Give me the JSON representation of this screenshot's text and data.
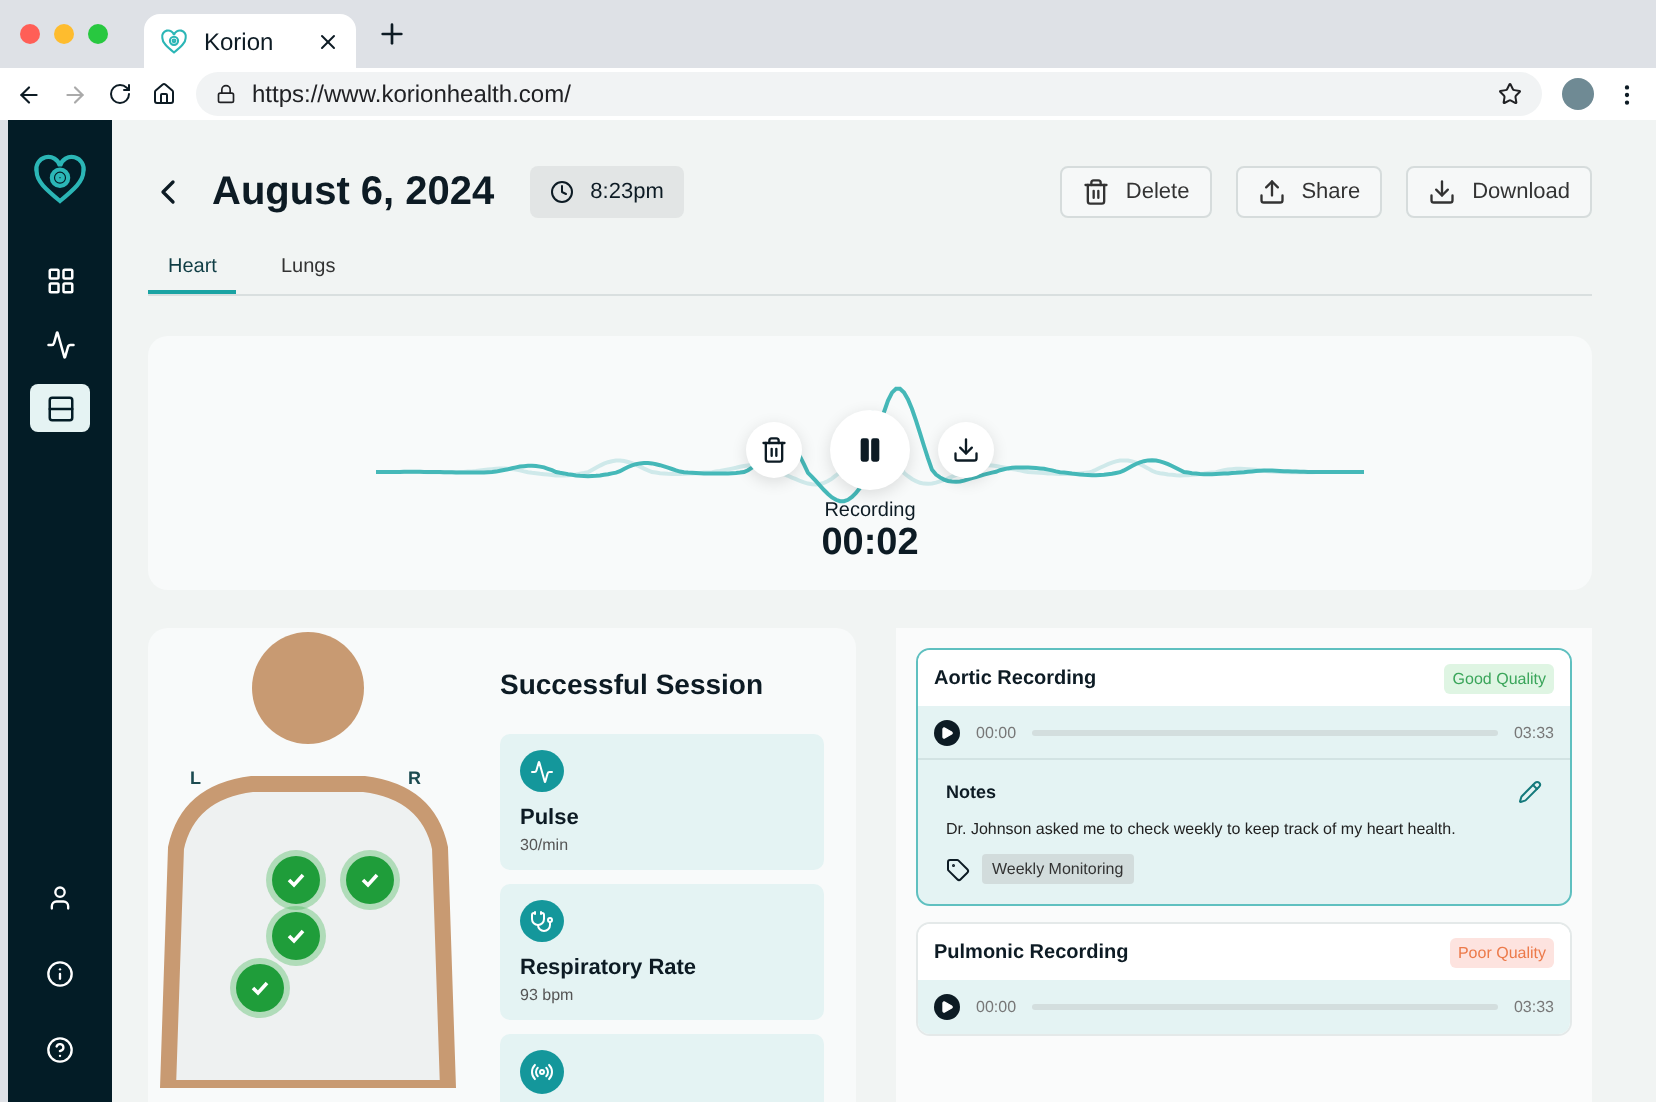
{
  "browser": {
    "tab_title": "Korion",
    "url": "https://www.korionhealth.com/"
  },
  "sidebar": {
    "items": [
      {
        "selected": false
      },
      {
        "selected": false
      },
      {
        "selected": true
      }
    ]
  },
  "header": {
    "title": "August 6, 2024",
    "time": "8:23pm",
    "actions": [
      {
        "label": "Delete"
      },
      {
        "label": "Share"
      },
      {
        "label": "Download"
      }
    ]
  },
  "tabs": [
    {
      "label": "Heart",
      "selected": true
    },
    {
      "label": "Lungs",
      "selected": false
    }
  ],
  "recorder": {
    "status": "Recording",
    "elapsed": "00:02",
    "paused": false
  },
  "session": {
    "title": "Successful Session",
    "side_left": "L",
    "side_right": "R",
    "points": [
      {
        "checked": true
      },
      {
        "checked": true
      },
      {
        "checked": true
      },
      {
        "checked": true
      }
    ],
    "metrics": [
      {
        "label": "Pulse",
        "value": "30/min"
      },
      {
        "label": "Respiratory Rate",
        "value": "93 bpm"
      }
    ]
  },
  "recordings": [
    {
      "title": "Aortic Recording",
      "quality": "Good Quality",
      "kind": "good",
      "selected": true,
      "current": "00:00",
      "duration": "03:33",
      "notes": {
        "title": "Notes",
        "text": "Dr. Johnson asked me to check weekly to keep track of my heart health.",
        "tag": "Weekly Monitoring"
      }
    },
    {
      "title": "Pulmonic Recording",
      "quality": "Poor Quality",
      "kind": "poor",
      "selected": false,
      "current": "00:00",
      "duration": "03:33"
    }
  ]
}
